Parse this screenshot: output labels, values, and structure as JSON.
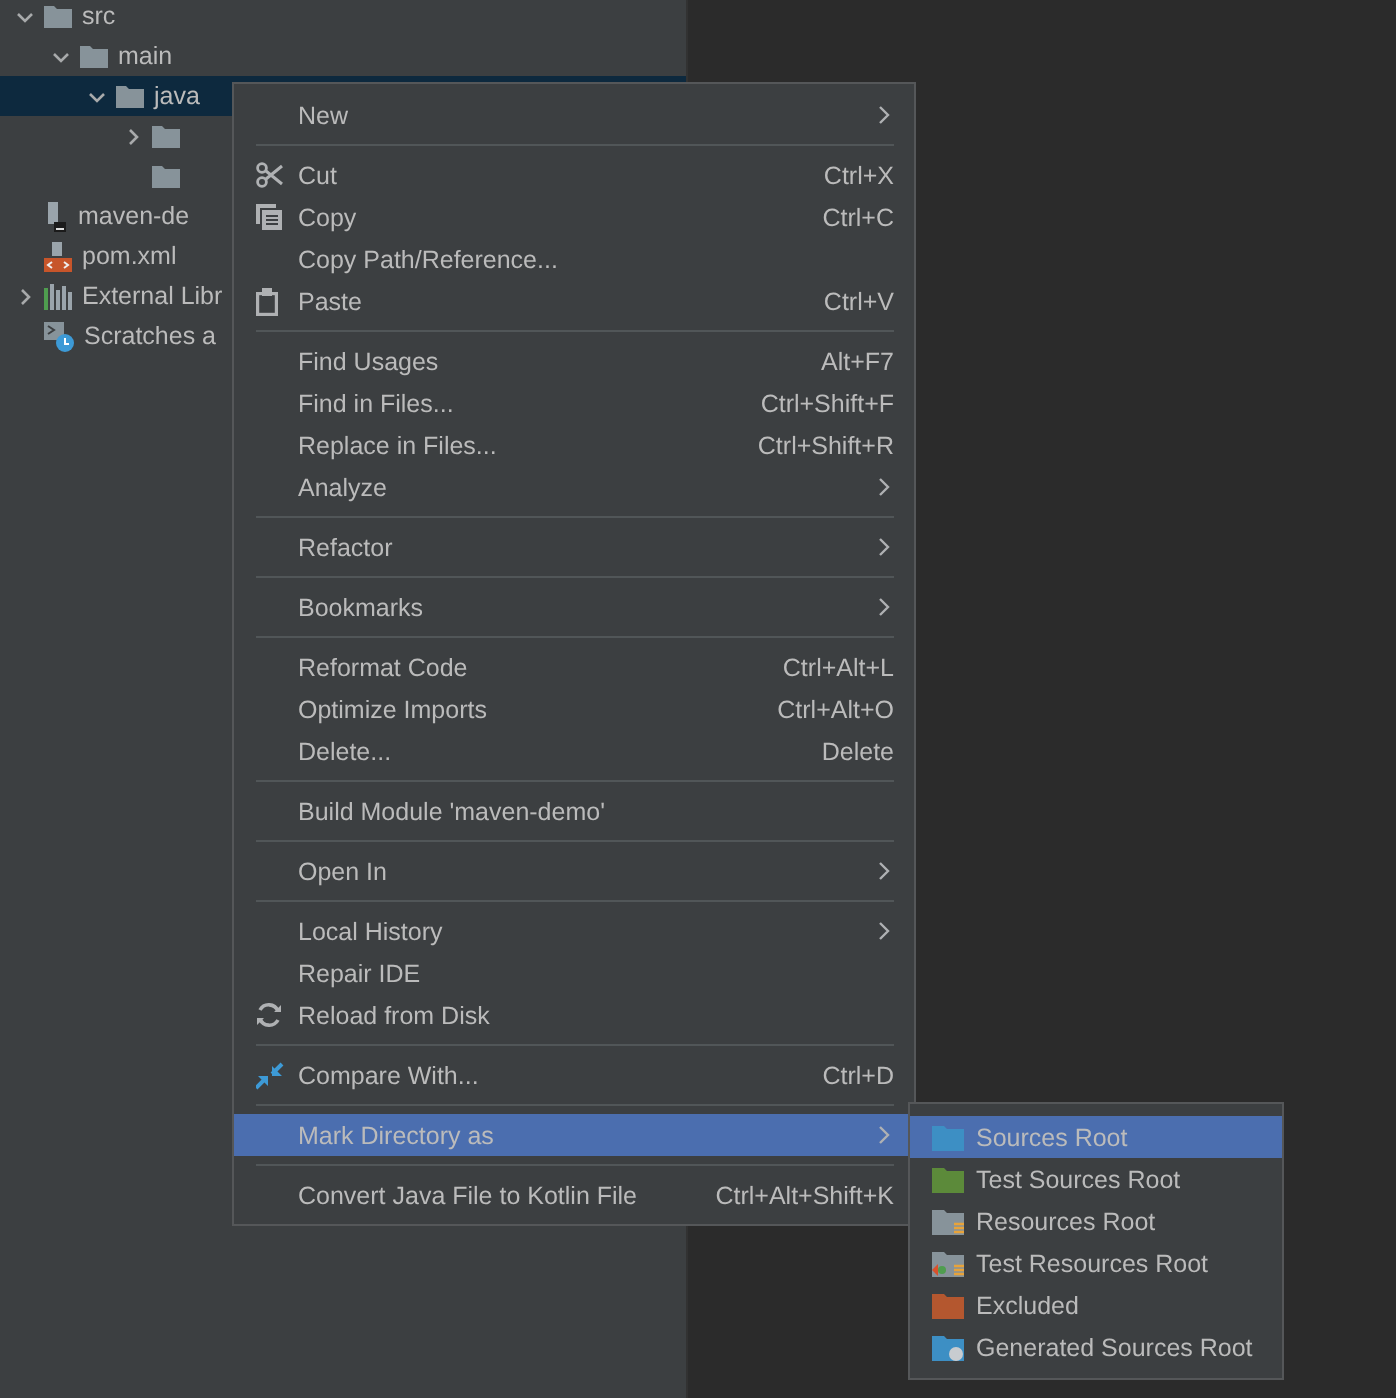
{
  "project_tree": [
    {
      "label": "src",
      "kind": "folder",
      "expanded": true,
      "selected": false,
      "children": [
        {
          "label": "main",
          "kind": "folder",
          "expanded": true,
          "selected": false,
          "children": [
            {
              "label": "java",
              "kind": "folder",
              "expanded": true,
              "selected": true,
              "children": [
                {
                  "kind": "folder",
                  "expanded": false,
                  "selected": false
                },
                {
                  "kind": "folder",
                  "selected": false
                }
              ]
            }
          ]
        }
      ]
    },
    {
      "label": "maven-de",
      "kind": "file",
      "selected": false
    },
    {
      "label": "pom.xml",
      "kind": "xml",
      "selected": false
    },
    {
      "label": "External Libr",
      "kind": "libraries",
      "expanded": false,
      "selected": false
    },
    {
      "label": "Scratches a",
      "kind": "scratches",
      "selected": false
    }
  ],
  "context_menu": {
    "items": [
      {
        "kind": "item",
        "label": "New",
        "submenu": true,
        "selected": false
      },
      {
        "kind": "separator"
      },
      {
        "kind": "cut",
        "label": "Cut",
        "shortcut": "Ctrl+X",
        "selected": false
      },
      {
        "kind": "copy",
        "label": "Copy",
        "shortcut": "Ctrl+C",
        "selected": false
      },
      {
        "kind": "item",
        "label": "Copy Path/Reference...",
        "selected": false
      },
      {
        "kind": "paste",
        "label": "Paste",
        "shortcut": "Ctrl+V",
        "selected": false
      },
      {
        "kind": "separator"
      },
      {
        "kind": "item",
        "label": "Find Usages",
        "shortcut": "Alt+F7",
        "selected": false
      },
      {
        "kind": "item",
        "label": "Find in Files...",
        "shortcut": "Ctrl+Shift+F",
        "selected": false
      },
      {
        "kind": "item",
        "label": "Replace in Files...",
        "shortcut": "Ctrl+Shift+R",
        "selected": false
      },
      {
        "kind": "item",
        "label": "Analyze",
        "submenu": true,
        "selected": false
      },
      {
        "kind": "separator"
      },
      {
        "kind": "item",
        "label": "Refactor",
        "submenu": true,
        "selected": false
      },
      {
        "kind": "separator"
      },
      {
        "kind": "item",
        "label": "Bookmarks",
        "submenu": true,
        "selected": false
      },
      {
        "kind": "separator"
      },
      {
        "kind": "item",
        "label": "Reformat Code",
        "shortcut": "Ctrl+Alt+L",
        "selected": false
      },
      {
        "kind": "item",
        "label": "Optimize Imports",
        "shortcut": "Ctrl+Alt+O",
        "selected": false
      },
      {
        "kind": "item",
        "label": "Delete...",
        "shortcut": "Delete",
        "selected": false
      },
      {
        "kind": "separator"
      },
      {
        "kind": "item",
        "label": "Build Module 'maven-demo'",
        "selected": false
      },
      {
        "kind": "separator"
      },
      {
        "kind": "item",
        "label": "Open In",
        "submenu": true,
        "selected": false
      },
      {
        "kind": "separator"
      },
      {
        "kind": "item",
        "label": "Local History",
        "submenu": true,
        "selected": false
      },
      {
        "kind": "item",
        "label": "Repair IDE",
        "selected": false
      },
      {
        "kind": "reload",
        "label": "Reload from Disk",
        "selected": false
      },
      {
        "kind": "separator"
      },
      {
        "kind": "compare",
        "label": "Compare With...",
        "shortcut": "Ctrl+D",
        "selected": false
      },
      {
        "kind": "separator"
      },
      {
        "kind": "item",
        "label": "Mark Directory as",
        "submenu": true,
        "selected": true
      },
      {
        "kind": "separator"
      },
      {
        "kind": "item",
        "label": "Convert Java File to Kotlin File",
        "shortcut": "Ctrl+Alt+Shift+K",
        "selected": false
      }
    ]
  },
  "submenu": {
    "items": [
      {
        "label": "Sources Root",
        "kind": "sources",
        "selected": true
      },
      {
        "label": "Test Sources Root",
        "kind": "test-sources",
        "selected": false
      },
      {
        "label": "Resources Root",
        "kind": "resources",
        "selected": false
      },
      {
        "label": "Test Resources Root",
        "kind": "test-resources",
        "selected": false
      },
      {
        "label": "Excluded",
        "kind": "excluded",
        "selected": false
      },
      {
        "label": "Generated Sources Root",
        "kind": "generated",
        "selected": false
      }
    ]
  }
}
